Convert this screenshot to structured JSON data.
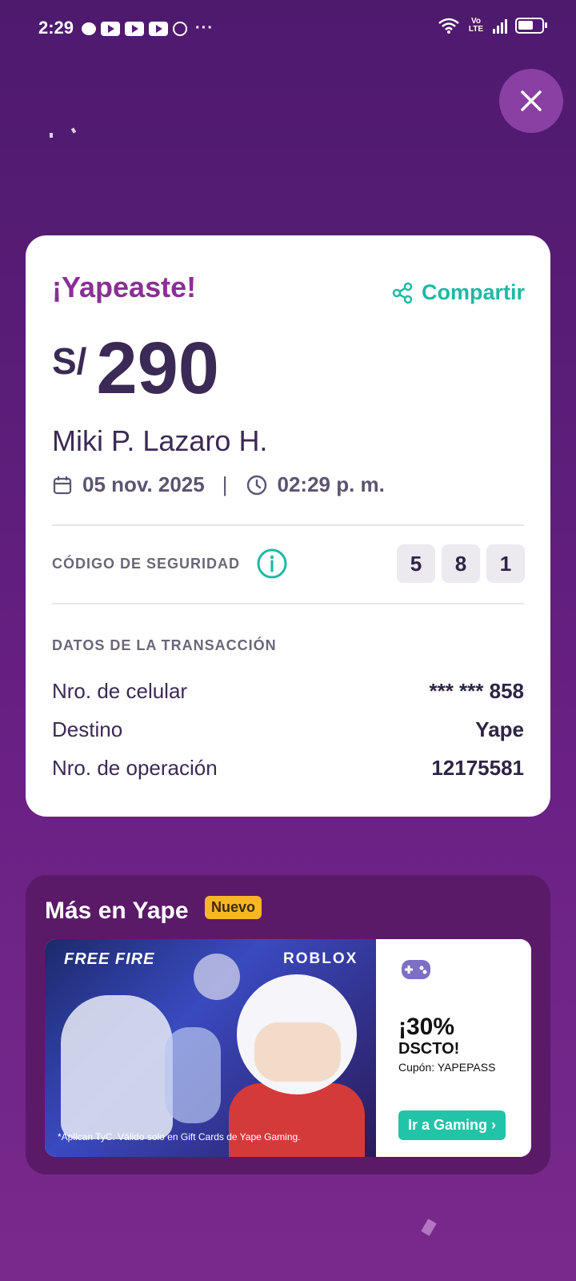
{
  "status": {
    "time": "2:29",
    "network": "Vo LTE",
    "dots": "···"
  },
  "receipt": {
    "title": "¡Yapeaste!",
    "share_label": "Compartir",
    "currency": "S/",
    "amount": "290",
    "recipient": "Miki P. Lazaro H.",
    "date": "05 nov. 2025",
    "separator": "|",
    "time": "02:29 p. m.",
    "security_label": "CÓDIGO DE SEGURIDAD",
    "security_code": [
      "5",
      "8",
      "1"
    ],
    "data_title": "DATOS DE LA TRANSACCIÓN",
    "rows": [
      {
        "label": "Nro. de celular",
        "value": "*** *** 858"
      },
      {
        "label": "Destino",
        "value": "Yape"
      },
      {
        "label": "Nro. de operación",
        "value": "12175581"
      }
    ]
  },
  "promo": {
    "title": "Más en Yape",
    "badge": "Nuevo",
    "free_fire": "FREE FIRE",
    "roblox": "ROBLOX",
    "disclaimer": "*Aplican TyC. Válido solo en Gift Cards de Yape Gaming.",
    "discount": "¡30%",
    "dscto": "DSCTO!",
    "coupon": "Cupón: YAPEPASS",
    "cta": "Ir a Gaming ›"
  },
  "colors": {
    "brand_purple": "#8a2f94",
    "accent_teal": "#1cbaa2",
    "badge_yellow": "#f8b625"
  }
}
